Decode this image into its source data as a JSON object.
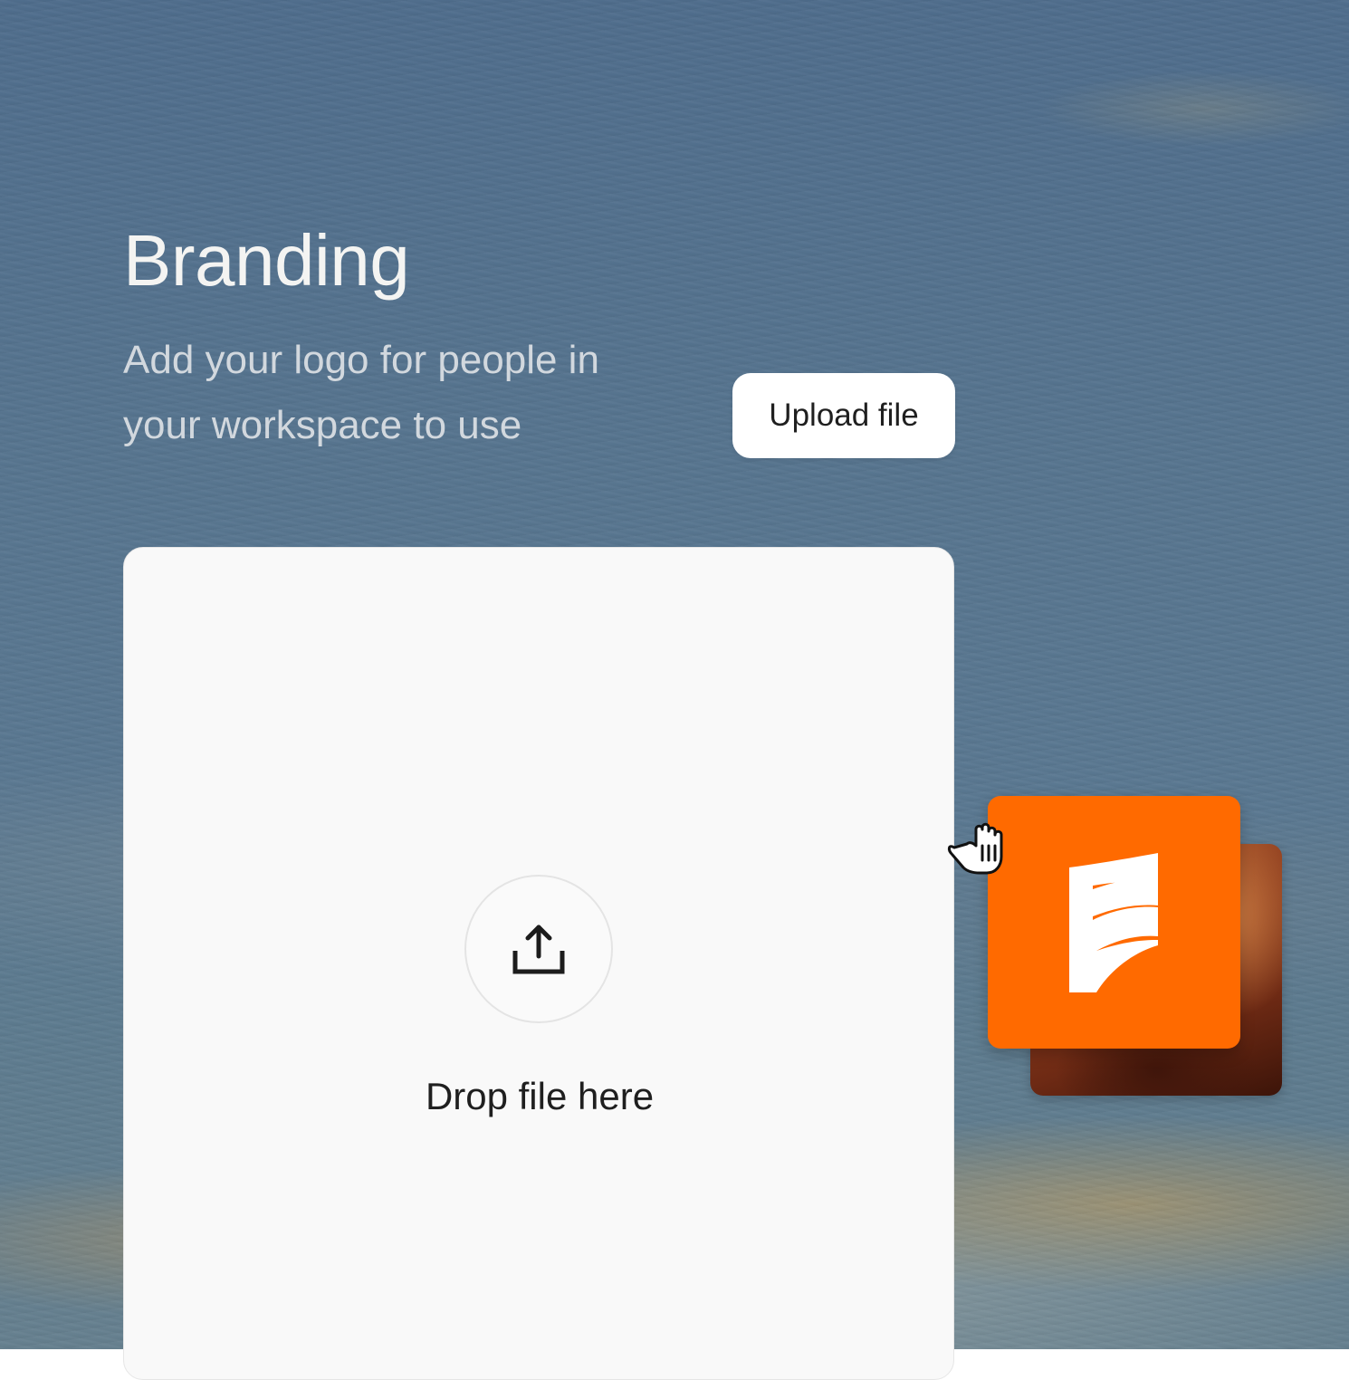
{
  "page": {
    "title": "Branding",
    "subtitle": "Add your logo for people in your workspace to use"
  },
  "upload": {
    "button_label": "Upload file"
  },
  "dropzone": {
    "label": "Drop file here",
    "icon": "upload-icon"
  },
  "dragged_file": {
    "logo_color": "#ff6a00",
    "icons": [
      "brand-logo-icon",
      "grab-cursor-icon"
    ]
  }
}
